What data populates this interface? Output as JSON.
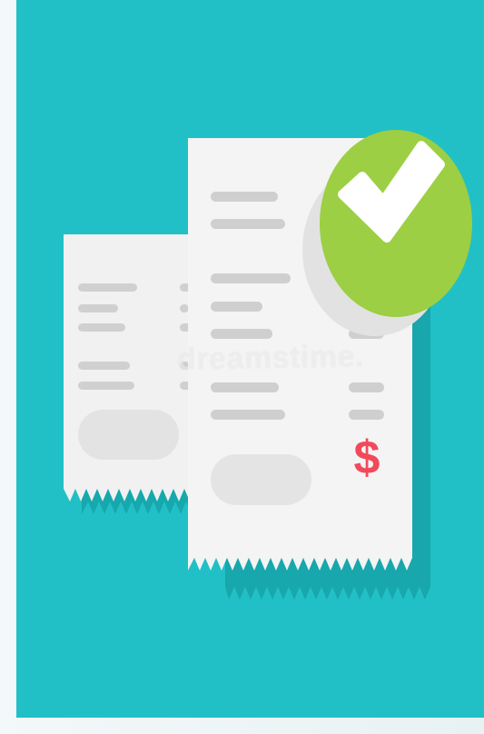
{
  "scene": {
    "colors": {
      "background": "#21c0c6",
      "receipt": "#f4f4f4",
      "receipt_shadow": "#18a6ab",
      "line": "#cfcfcf",
      "pill": "#e4e4e4",
      "check_green": "#9ccf43",
      "check_white": "#ffffff",
      "dollar_red": "#f14a5a"
    },
    "dollar_symbol": "$",
    "watermark_text": "dreamstime."
  }
}
